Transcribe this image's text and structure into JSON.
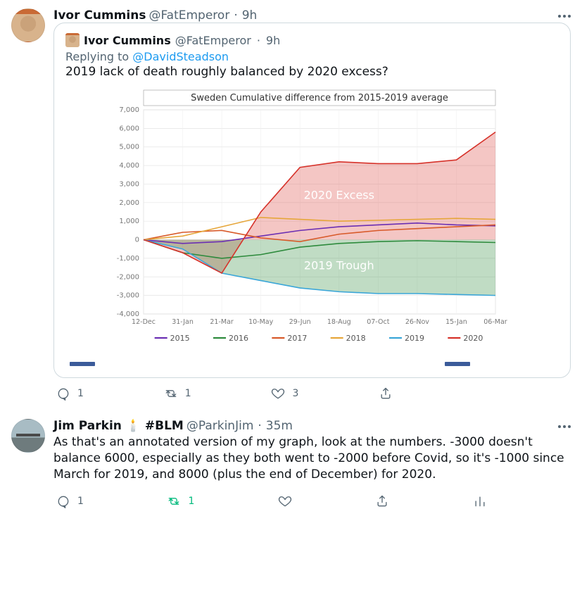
{
  "tweet1": {
    "name": "Ivor Cummins",
    "handle": "@FatEmperor",
    "time": "9h",
    "card": {
      "name": "Ivor Cummins",
      "handle": "@FatEmperor",
      "time": "9h",
      "replyLabel": "Replying to ",
      "replyHandle": "@DavidSteadson",
      "body": "2019 lack of death roughly balanced by 2020 excess?"
    },
    "actions": {
      "reply": "1",
      "retweet": "1",
      "like": "3"
    }
  },
  "tweet2": {
    "name": "Jim Parkin 🕯️ #BLM",
    "handle": "@ParkinJim",
    "time": "35m",
    "body": "As that's an annotated version of my graph, look at the numbers. -3000 doesn't balance 6000, especially as they both went to -2000 before Covid, so it's -1000 since March for 2019, and 8000 (plus the end of December) for 2020.",
    "actions": {
      "reply": "1",
      "retweet": "1"
    }
  },
  "chart_data": {
    "type": "line",
    "title": "Sweden Cumulative difference from 2015-2019 average",
    "xlabel": "",
    "ylabel": "",
    "ylim": [
      -4000,
      7000
    ],
    "x_categories": [
      "12-Dec",
      "31-Jan",
      "21-Mar",
      "10-May",
      "29-Jun",
      "18-Aug",
      "07-Oct",
      "26-Nov",
      "15-Jan",
      "06-Mar"
    ],
    "y_ticks": [
      -4000,
      -3000,
      -2000,
      -1000,
      0,
      1000,
      2000,
      3000,
      4000,
      5000,
      6000,
      7000
    ],
    "series": [
      {
        "name": "2015",
        "color": "#6b2fb3",
        "values": [
          0,
          -200,
          -100,
          200,
          500,
          700,
          800,
          900,
          800,
          750
        ]
      },
      {
        "name": "2016",
        "color": "#2e8b3d",
        "values": [
          0,
          -700,
          -1000,
          -800,
          -400,
          -200,
          -100,
          -50,
          -100,
          -150
        ]
      },
      {
        "name": "2017",
        "color": "#d85a2a",
        "values": [
          0,
          400,
          500,
          100,
          -100,
          300,
          500,
          600,
          700,
          800
        ]
      },
      {
        "name": "2018",
        "color": "#e6a63a",
        "values": [
          0,
          200,
          700,
          1200,
          1100,
          1000,
          1050,
          1100,
          1150,
          1100
        ]
      },
      {
        "name": "2019",
        "color": "#3aa6d8",
        "values": [
          0,
          -500,
          -1800,
          -2200,
          -2600,
          -2800,
          -2900,
          -2900,
          -2950,
          -3000
        ]
      },
      {
        "name": "2020",
        "color": "#d6322a",
        "values": [
          0,
          -700,
          -1800,
          1500,
          3900,
          4200,
          4100,
          4100,
          4300,
          5800
        ]
      }
    ],
    "annotations": [
      {
        "label": "2020 Excess",
        "fill": "rgba(214,50,42,0.28)",
        "text_x": "18-Aug",
        "text_y": 2200
      },
      {
        "label": "2019 Trough",
        "fill": "rgba(46,139,61,0.30)",
        "text_x": "18-Aug",
        "text_y": -1600
      }
    ]
  }
}
